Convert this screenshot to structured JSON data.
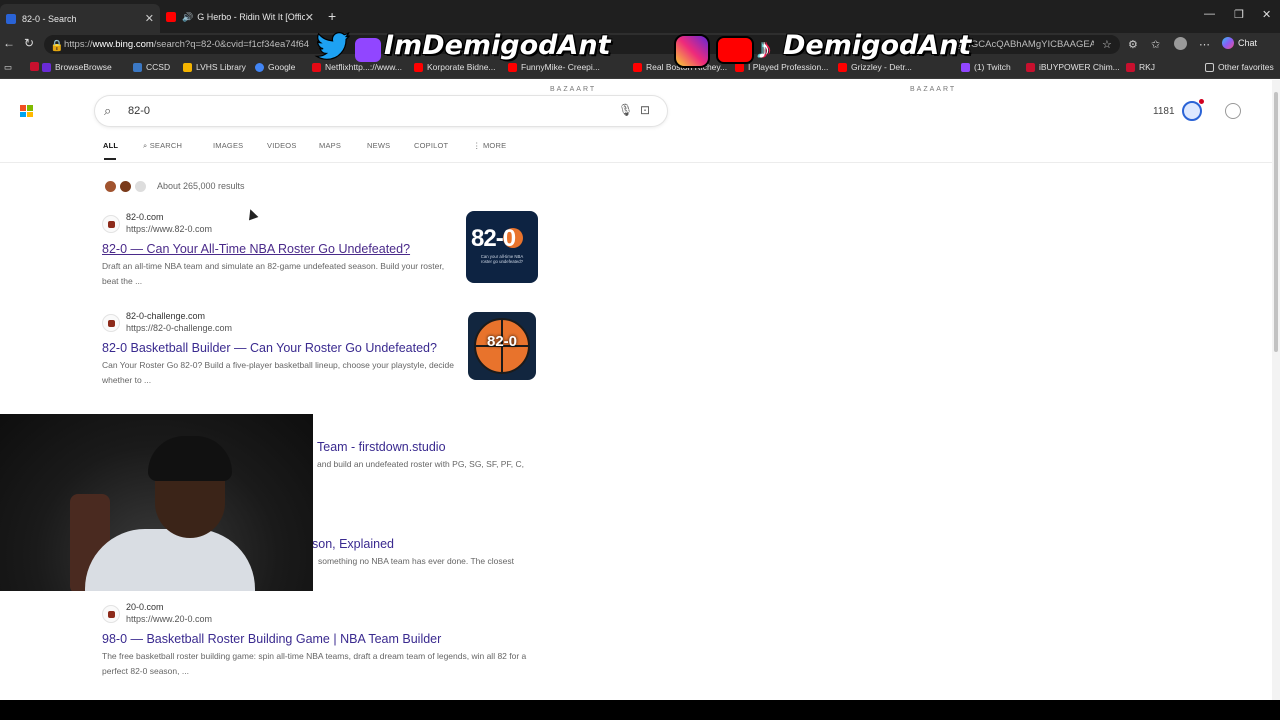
{
  "tabs": [
    {
      "title": "82-0 - Search",
      "active": true
    },
    {
      "title": "G Herbo - Ridin Wit It [Officia",
      "active": false
    }
  ],
  "address": {
    "url_prefix": "https://",
    "url_domain": "www.bing.com",
    "url_rest": "/search?q=82-0&cvid=f1cf34ea74f64",
    "url_tail_visible": "QDIGCAcQABhAMgYICBAAGEA..."
  },
  "chat_label": "Chat",
  "favorites": [
    "BrowseBrowse",
    "CCSD",
    "LVHS Library",
    "Google",
    "Netflixhttp...://www...",
    "Korporate Bidne...",
    "FunnyMike- Creepi...",
    "Real Boston Richey...",
    "I Played Profession...",
    "Grizzley - Detr...",
    "(1) Twitch",
    "iBUYPOWER Chim...",
    "RKJ"
  ],
  "other_favorites": "Other favorites",
  "overlay": {
    "handle_left": "ImDemigodAnt",
    "handle_right": "DemigodAnt"
  },
  "search": {
    "query": "82-0",
    "bazaart_label": "BAZAART"
  },
  "rewards_points": "1181",
  "nav_tabs": [
    {
      "label": "ALL",
      "active": true
    },
    {
      "label": "SEARCH",
      "active": false
    },
    {
      "label": "IMAGES",
      "active": false
    },
    {
      "label": "VIDEOS",
      "active": false
    },
    {
      "label": "MAPS",
      "active": false
    },
    {
      "label": "NEWS",
      "active": false
    },
    {
      "label": "COPILOT",
      "active": false
    },
    {
      "label": "MORE",
      "active": false
    }
  ],
  "result_count": "About 265,000 results",
  "results": [
    {
      "site": "82-0.com",
      "url": "https://www.82-0.com",
      "title": "82-0 — Can Your All-Time NBA Roster Go Undefeated?",
      "snippet": "Draft an all-time NBA team and simulate an 82-game undefeated season. Build your roster, beat the ...",
      "visited": true
    },
    {
      "site": "82-0-challenge.com",
      "url": "https://82-0-challenge.com",
      "title": "82-0 Basketball Builder — Can Your Roster Go Undefeated?",
      "snippet": "Can Your Roster Go 82-0? Build a five-player basketball lineup, choose your playstyle, decide whether to ...",
      "visited": false
    },
    {
      "title": "Team - firstdown.studio",
      "snippet": "and build an undefeated roster with PG, SG, SF, PF, C,"
    },
    {
      "title": "son, Explained",
      "snippet": "something no NBA team has ever done. The closest"
    },
    {
      "site": "20-0.com",
      "url": "https://www.20-0.com",
      "title": "98-0 — Basketball Roster Building Game | NBA Team Builder",
      "snippet": "The free basketball roster building game: spin all-time NBA teams, draft a dream team of legends, win all 82 for a perfect 82-0 season, ...",
      "visited": false
    }
  ],
  "thumbs": {
    "thumb1_big": "82-0",
    "thumb1_small": "Can your all-time NBA roster go undefeated?",
    "thumb2_text": "82-0"
  },
  "colors": {
    "result_title": "#3a2a8f",
    "chrome_dark": "#2e2e2e"
  }
}
